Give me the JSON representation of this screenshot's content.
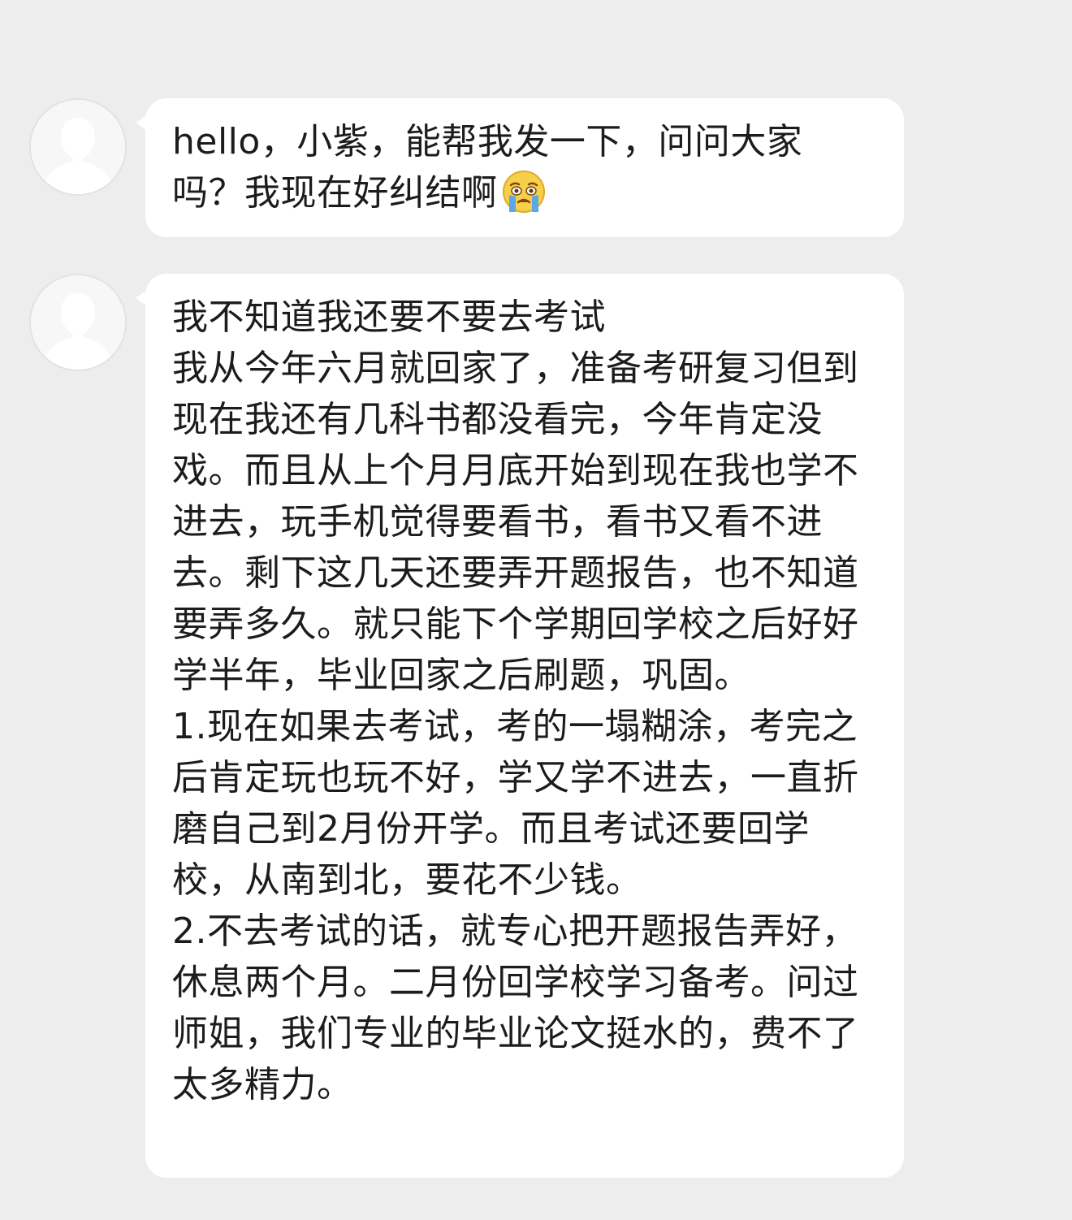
{
  "messages": [
    {
      "sender": "other",
      "text": "hello，小紫，能帮我发一下，问问大家吗？我现在好纠结啊",
      "emoji": "crying-face"
    },
    {
      "sender": "other",
      "text": "我不知道我还要不要去考试\n我从今年六月就回家了，准备考研复习但到现在我还有几科书都没看完，今年肯定没戏。而且从上个月月底开始到现在我也学不进去，玩手机觉得要看书，看书又看不进去。剩下这几天还要弄开题报告，也不知道要弄多久。就只能下个学期回学校之后好好学半年，毕业回家之后刷题，巩固。\n1.现在如果去考试，考的一塌糊涂，考完之后肯定玩也玩不好，学又学不进去，一直折磨自己到2月份开学。而且考试还要回学校，从南到北，要花不少钱。\n2.不去考试的话，就专心把开题报告弄好，休息两个月。二月份回学校学习备考。问过师姐，我们专业的毕业论文挺水的，费不了太多精力。"
    }
  ],
  "colors": {
    "background": "#ededed",
    "bubble": "#ffffff",
    "text": "#1c1c1c",
    "avatar_bg": "#f7f7f7",
    "avatar_silhouette": "#ffffff"
  }
}
